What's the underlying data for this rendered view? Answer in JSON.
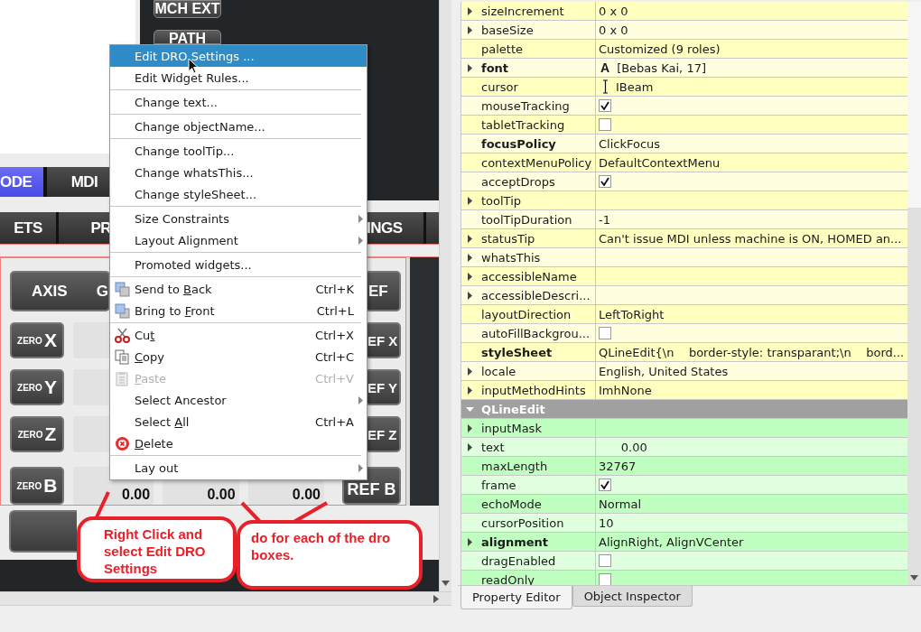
{
  "canvas": {
    "side_buttons": [
      "MCH EXT",
      "PATH"
    ],
    "tab_row_1": [
      {
        "label": "ODE",
        "selected": true
      },
      {
        "label": "MDI",
        "selected": false
      }
    ],
    "tab_row_2": [
      {
        "label": "ETS",
        "selected": false
      },
      {
        "label": "PR",
        "selected": false
      },
      {
        "label": "INGS",
        "selected": false
      }
    ],
    "dro_header": {
      "axis": "AXIS",
      "column_2": "G",
      "ref": "EF"
    },
    "dro_rows": [
      {
        "prefix": "ZERO",
        "axis": "X",
        "values": [],
        "ref": "EF X"
      },
      {
        "prefix": "ZERO",
        "axis": "Y",
        "values": [],
        "ref": "EF Y"
      },
      {
        "prefix": "ZERO",
        "axis": "Z",
        "values": [],
        "ref": "EF Z"
      },
      {
        "prefix": "ZERO",
        "axis": "B",
        "values": [
          "0.00",
          "0.00",
          "0.00"
        ],
        "ref": "REF B"
      }
    ]
  },
  "context_menu": [
    {
      "kind": "item",
      "label": "Edit DRO Settings ...",
      "selected": true,
      "disabled": false,
      "submenu": false
    },
    {
      "kind": "item",
      "label": "Edit Widget Rules...",
      "selected": false,
      "disabled": false,
      "submenu": false
    },
    {
      "kind": "separator"
    },
    {
      "kind": "item",
      "label": "Change text...",
      "selected": false,
      "disabled": false,
      "submenu": false
    },
    {
      "kind": "separator"
    },
    {
      "kind": "item",
      "label": "Change objectName...",
      "selected": false,
      "disabled": false,
      "submenu": false
    },
    {
      "kind": "separator"
    },
    {
      "kind": "item",
      "label": "Change toolTip...",
      "selected": false,
      "disabled": false,
      "submenu": false
    },
    {
      "kind": "item",
      "label": "Change whatsThis...",
      "selected": false,
      "disabled": false,
      "submenu": false
    },
    {
      "kind": "item",
      "label": "Change styleSheet...",
      "selected": false,
      "disabled": false,
      "submenu": false
    },
    {
      "kind": "separator"
    },
    {
      "kind": "item",
      "label": "Size Constraints",
      "selected": false,
      "disabled": false,
      "submenu": true
    },
    {
      "kind": "item",
      "label": "Layout Alignment",
      "selected": false,
      "disabled": false,
      "submenu": true
    },
    {
      "kind": "separator"
    },
    {
      "kind": "item",
      "label": "Promoted widgets...",
      "selected": false,
      "disabled": false,
      "submenu": false
    },
    {
      "kind": "separator"
    },
    {
      "kind": "item",
      "pre": "Send to ",
      "key": "B",
      "post": "ack",
      "shortcut": "Ctrl+K",
      "selected": false,
      "disabled": false,
      "submenu": false
    },
    {
      "kind": "item",
      "pre": "Bring to ",
      "key": "F",
      "post": "ront",
      "shortcut": "Ctrl+L",
      "selected": false,
      "disabled": false,
      "submenu": false
    },
    {
      "kind": "separator"
    },
    {
      "kind": "item",
      "pre": "Cu",
      "key": "t",
      "shortcut": "Ctrl+X",
      "selected": false,
      "disabled": false,
      "submenu": false
    },
    {
      "kind": "item",
      "key": "C",
      "post": "opy",
      "shortcut": "Ctrl+C",
      "selected": false,
      "disabled": false,
      "submenu": false
    },
    {
      "kind": "item",
      "key": "P",
      "post": "aste",
      "shortcut": "Ctrl+V",
      "selected": false,
      "disabled": true,
      "submenu": false
    },
    {
      "kind": "item",
      "label": "Select Ancestor",
      "selected": false,
      "disabled": false,
      "submenu": true
    },
    {
      "kind": "item",
      "pre": "Select ",
      "key": "A",
      "post": "ll",
      "shortcut": "Ctrl+A",
      "selected": false,
      "disabled": false,
      "submenu": false
    },
    {
      "kind": "item",
      "key": "D",
      "post": "elete",
      "selected": false,
      "disabled": false,
      "submenu": false
    },
    {
      "kind": "separator"
    },
    {
      "kind": "item",
      "label": "Lay out",
      "selected": false,
      "disabled": false,
      "submenu": true
    }
  ],
  "callouts": [
    "Right Click and select Edit DRO Settings",
    "do for each of the dro boxes."
  ],
  "property_sections": [
    {
      "color": "#ffffbf",
      "rows": [
        {
          "name": "sizeIncrement",
          "expandable": true,
          "bold": false,
          "kind": "text",
          "value": "0 x 0"
        },
        {
          "name": "baseSize",
          "expandable": true,
          "bold": false,
          "kind": "text",
          "value": "0 x 0"
        },
        {
          "name": "palette",
          "expandable": false,
          "bold": false,
          "kind": "text",
          "value": "Customized (9 roles)"
        },
        {
          "name": "font",
          "expandable": true,
          "bold": true,
          "kind": "font",
          "icon_text": "A",
          "value": "[Bebas Kai, 17]"
        },
        {
          "name": "cursor",
          "expandable": false,
          "bold": false,
          "kind": "cursor",
          "value": "IBeam"
        },
        {
          "name": "mouseTracking",
          "expandable": false,
          "bold": false,
          "kind": "checkbox",
          "checked": true
        },
        {
          "name": "tabletTracking",
          "expandable": false,
          "bold": false,
          "kind": "checkbox",
          "checked": false
        },
        {
          "name": "focusPolicy",
          "expandable": false,
          "bold": true,
          "kind": "text",
          "value": "ClickFocus"
        },
        {
          "name": "contextMenuPolicy",
          "expandable": false,
          "bold": false,
          "kind": "text",
          "value": "DefaultContextMenu"
        },
        {
          "name": "acceptDrops",
          "expandable": false,
          "bold": false,
          "kind": "checkbox",
          "checked": true
        },
        {
          "name": "toolTip",
          "expandable": true,
          "bold": false,
          "kind": "empty"
        },
        {
          "name": "toolTipDuration",
          "expandable": false,
          "bold": false,
          "kind": "text",
          "value": "-1"
        },
        {
          "name": "statusTip",
          "expandable": true,
          "bold": false,
          "kind": "text",
          "value": "Can't issue MDI unless machine is ON, HOMED an..."
        },
        {
          "name": "whatsThis",
          "expandable": true,
          "bold": false,
          "kind": "empty"
        },
        {
          "name": "accessibleName",
          "expandable": true,
          "bold": false,
          "kind": "empty"
        },
        {
          "name": "accessibleDescri...",
          "expandable": true,
          "bold": false,
          "kind": "empty"
        },
        {
          "name": "layoutDirection",
          "expandable": false,
          "bold": false,
          "kind": "text",
          "value": "LeftToRight"
        },
        {
          "name": "autoFillBackgrou...",
          "expandable": false,
          "bold": false,
          "kind": "checkbox",
          "checked": false
        },
        {
          "name": "styleSheet",
          "expandable": false,
          "bold": true,
          "kind": "text",
          "value": "QLineEdit{\\n    border-style: transparant;\\n    bord..."
        },
        {
          "name": "locale",
          "expandable": true,
          "bold": false,
          "kind": "text",
          "value": "English, United States"
        },
        {
          "name": "inputMethodHints",
          "expandable": true,
          "bold": false,
          "kind": "text",
          "value": "ImhNone"
        }
      ]
    },
    {
      "header": "QLineEdit",
      "expanded": true,
      "color": "#bfffbf",
      "rows": [
        {
          "name": "inputMask",
          "expandable": true,
          "bold": false,
          "kind": "empty"
        },
        {
          "name": "text",
          "expandable": true,
          "bold": false,
          "kind": "text",
          "value": "      0.00"
        },
        {
          "name": "maxLength",
          "expandable": false,
          "bold": false,
          "kind": "text",
          "value": "32767"
        },
        {
          "name": "frame",
          "expandable": false,
          "bold": false,
          "kind": "checkbox",
          "checked": true
        },
        {
          "name": "echoMode",
          "expandable": false,
          "bold": false,
          "kind": "text",
          "value": "Normal"
        },
        {
          "name": "cursorPosition",
          "expandable": false,
          "bold": false,
          "kind": "text",
          "value": "10"
        },
        {
          "name": "alignment",
          "expandable": true,
          "bold": true,
          "kind": "text",
          "value": "AlignRight, AlignVCenter"
        },
        {
          "name": "dragEnabled",
          "expandable": false,
          "bold": false,
          "kind": "checkbox",
          "checked": false
        },
        {
          "name": "readOnly",
          "expandable": false,
          "bold": false,
          "kind": "checkbox",
          "checked": false
        }
      ]
    }
  ],
  "panel_tabs": [
    {
      "label": "Property Editor",
      "selected": true
    },
    {
      "label": "Object Inspector",
      "selected": false
    }
  ]
}
